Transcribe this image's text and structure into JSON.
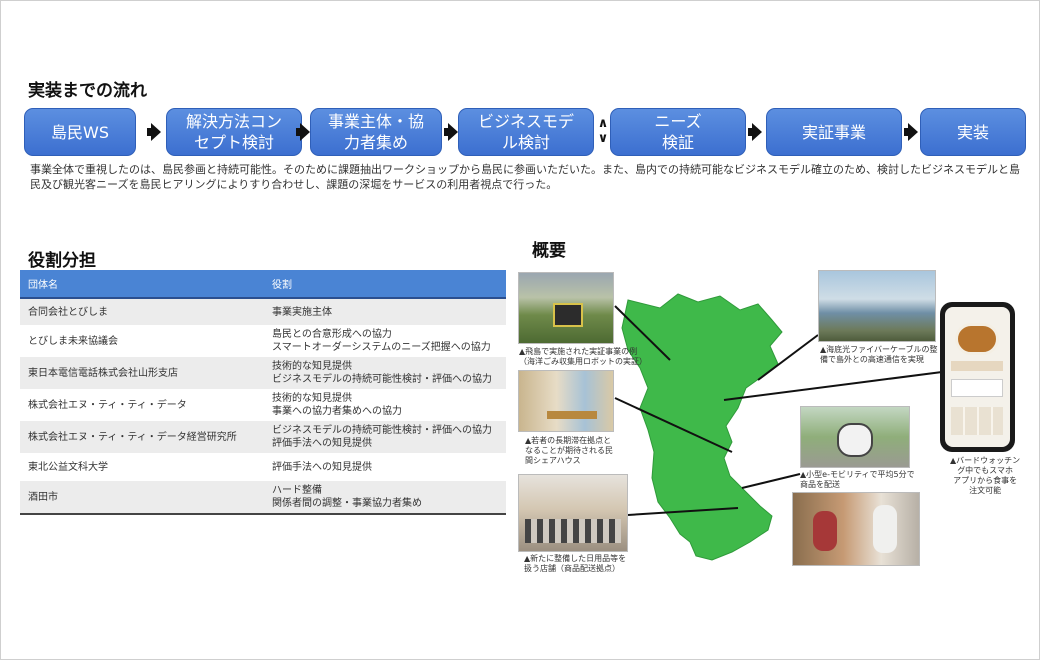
{
  "flow_section": {
    "title": "実装までの流れ",
    "steps": [
      {
        "line1": "島民WS",
        "line2": ""
      },
      {
        "line1": "解決方法コン",
        "line2": "セプト検討"
      },
      {
        "line1": "事業主体・協",
        "line2": "力者集め"
      },
      {
        "line1": "ビジネスモデ",
        "line2": "ル検討"
      },
      {
        "line1": "ニーズ",
        "line2": "検証"
      },
      {
        "line1": "実証事業",
        "line2": ""
      },
      {
        "line1": "実装",
        "line2": ""
      }
    ],
    "description": "事業全体で重視したのは、島民参画と持続可能性。そのために課題抽出ワークショップから島民に参画いただいた。また、島内での持続可能なビジネスモデル確立のため、検討したビジネスモデルと島民及び観光客ニーズを島民ヒアリングによりすり合わせし、課題の深堀をサービスの利用者視点で行った。"
  },
  "roles_section": {
    "title": "役割分担",
    "headers": [
      "団体名",
      "役割"
    ],
    "rows": [
      {
        "org": "合同会社とびしま",
        "role1": "事業実施主体",
        "role2": ""
      },
      {
        "org": "とびしま未来協議会",
        "role1": "島民との合意形成への協力",
        "role2": "スマートオーダーシステムのニーズ把握への協力"
      },
      {
        "org": "東日本電信電話株式会社山形支店",
        "role1": "技術的な知見提供",
        "role2": "ビジネスモデルの持続可能性検討・評価への協力"
      },
      {
        "org": "株式会社エヌ・ティ・ティ・データ",
        "role1": "技術的な知見提供",
        "role2": "事業への協力者集めへの協力"
      },
      {
        "org": "株式会社エヌ・ティ・ティ・データ経営研究所",
        "role1": "ビジネスモデルの持続可能性検討・評価への協力",
        "role2": "評価手法への知見提供"
      },
      {
        "org": "東北公益文科大学",
        "role1": "評価手法への知見提供",
        "role2": ""
      },
      {
        "org": "酒田市",
        "role1": "ハード整備",
        "role2": "関係者間の調整・事業協力者集め"
      }
    ]
  },
  "overview_section": {
    "title": "概要",
    "captions": {
      "robot": "▲飛島で実施された実証事業の例\n（海洋ごみ収集用ロボットの実証）",
      "share_house": "▲若者の長期滞在拠点と\nなることが期待される民\n間シェアハウス",
      "store": "▲新たに整備した日用品等を\n扱う店舗（商品配送拠点）",
      "fiber": "▲海底光ファイバーケーブルの整\n備で島外との高速通信を実現",
      "mobility": "▲小型e-モビリティで平均5分で\n商品を配送",
      "app": "▲バードウォッチン\nグ中でもスマホ\nアプリから食事を\n注文可能"
    },
    "colors": {
      "island": "#3fb94a",
      "flow_step": "#4a7fd8",
      "table_header": "#4a84d4"
    }
  }
}
